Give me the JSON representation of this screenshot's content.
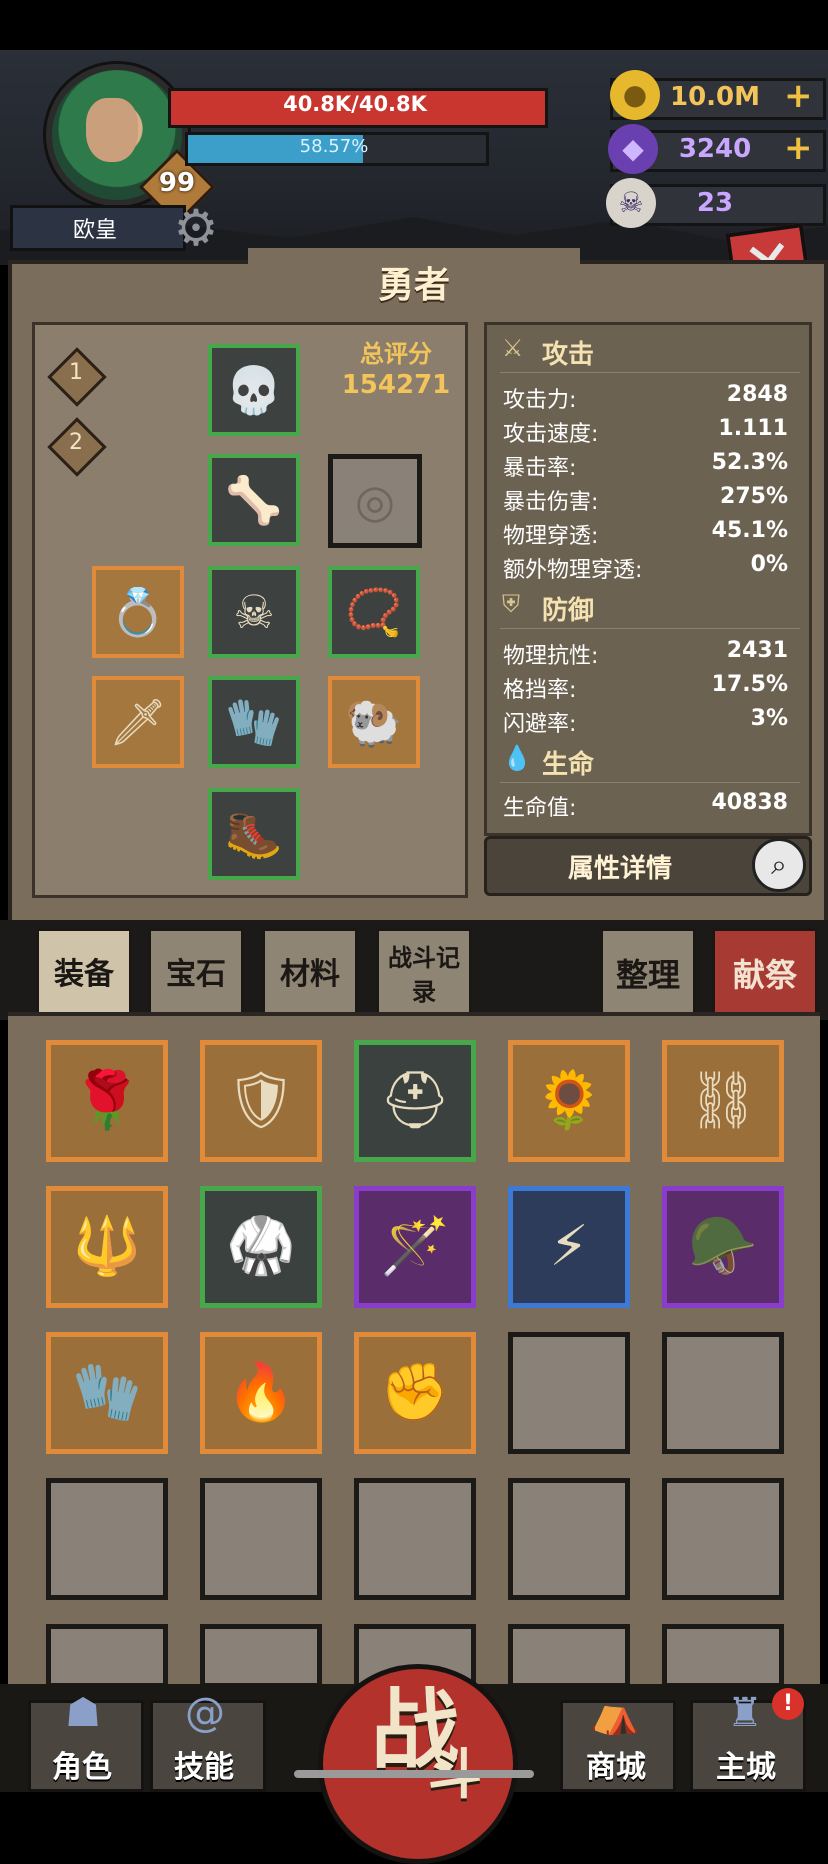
{
  "player": {
    "name": "欧皇",
    "level": "99",
    "hp_text": "40.8K/40.8K",
    "exp_text": "58.57%",
    "exp_progress": 0.5857
  },
  "resources": {
    "gold": "10.0M",
    "gems": "3240",
    "ram_tokens": "23",
    "plus": "+"
  },
  "panel": {
    "title": "勇者",
    "slot_tabs": [
      "1",
      "2"
    ],
    "score_label": "总评分",
    "score_value": "154271"
  },
  "stats": {
    "attack_header": "攻击",
    "attack": [
      {
        "label": "攻击力:",
        "value": "2848"
      },
      {
        "label": "攻击速度:",
        "value": "1.111"
      },
      {
        "label": "暴击率:",
        "value": "52.3%"
      },
      {
        "label": "暴击伤害:",
        "value": "275%"
      },
      {
        "label": "物理穿透:",
        "value": "45.1%"
      },
      {
        "label": "额外物理穿透:",
        "value": "0%"
      }
    ],
    "defense_header": "防御",
    "defense": [
      {
        "label": "物理抗性:",
        "value": "2431"
      },
      {
        "label": "格挡率:",
        "value": "17.5%"
      },
      {
        "label": "闪避率:",
        "value": "3%"
      }
    ],
    "life_header": "生命",
    "life": [
      {
        "label": "生命值:",
        "value": "40838"
      }
    ],
    "details_button": "属性详情"
  },
  "tabs": {
    "equipment": "装备",
    "gems": "宝石",
    "materials": "材料",
    "battle_log": "战斗记录",
    "sort": "整理",
    "sacrifice": "献祭"
  },
  "nav": {
    "character": "角色",
    "skills": "技能",
    "battle_main": "战",
    "battle_sub": "斗",
    "shop": "商城",
    "main_city": "主城",
    "alert": "!"
  },
  "colors": {
    "hp": "#c8362f",
    "exp": "#3b9fc9",
    "gold_text": "#f2c45a",
    "gem_text": "#c9a6ff",
    "rarity_green": "#46a84b",
    "rarity_orange": "#e08a3a",
    "rarity_purple": "#8a3dcc",
    "rarity_blue": "#3d7ad6"
  }
}
